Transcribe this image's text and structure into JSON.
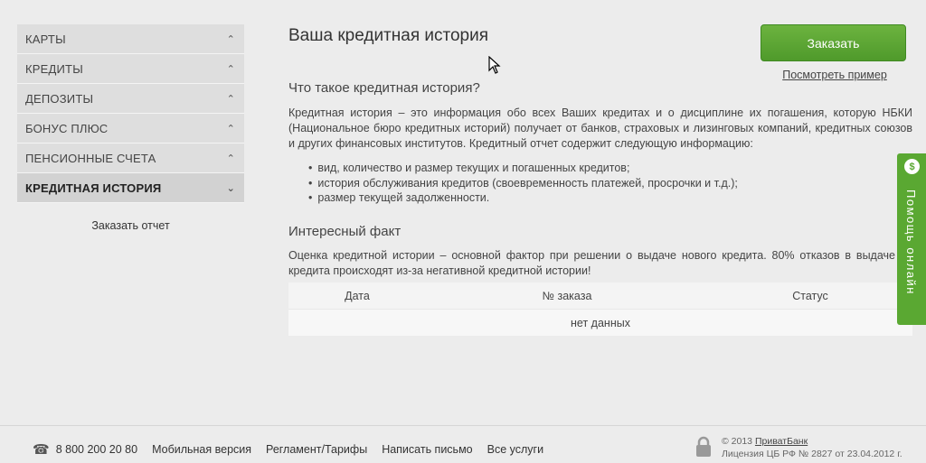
{
  "sidebar": {
    "items": [
      {
        "label": "КАРТЫ"
      },
      {
        "label": "КРЕДИТЫ"
      },
      {
        "label": "ДЕПОЗИТЫ"
      },
      {
        "label": "БОНУС ПЛЮС"
      },
      {
        "label": "ПЕНСИОННЫЕ СЧЕТА"
      },
      {
        "label": "КРЕДИТНАЯ ИСТОРИЯ"
      }
    ],
    "order_report": "Заказать отчет"
  },
  "main": {
    "title": "Ваша кредитная история",
    "what_heading": "Что такое кредитная история?",
    "what_text": "Кредитная история – это информация обо всех Ваших кредитах и о дисциплине их погашения, которую НБКИ (Национальное бюро кредитных историй) получает от банков, страховых и лизинговых компаний, кредитных союзов и других финансовых институтов. Кредитный отчет содержит следующую информацию:",
    "bullets": [
      "вид, количество и размер текущих и погашенных кредитов;",
      "история обслуживания кредитов (своевременность платежей, просрочки и т.д.);",
      "размер текущей задолженности."
    ],
    "fact_heading": "Интересный факт",
    "fact_text": "Оценка кредитной истории – основной фактор при решении о выдаче нового кредита. 80% отказов в выдаче кредита происходят из-за негативной кредитной истории!"
  },
  "order": {
    "button": "Заказать",
    "example_link": "Посмотреть пример"
  },
  "table": {
    "col_date": "Дата",
    "col_number": "№ заказа",
    "col_status": "Статус",
    "empty": "нет данных"
  },
  "help": {
    "icon": "$",
    "label": "Помощь онлайн"
  },
  "footer": {
    "phone": "8 800 200 20 80",
    "mobile": "Мобильная версия",
    "rules": "Регламент/Тарифы",
    "write": "Написать письмо",
    "services": "Все услуги",
    "copyright_prefix": "© 2013 ",
    "bank": "ПриватБанк",
    "license": "Лицензия ЦБ РФ № 2827 от 23.04.2012 г."
  },
  "icons": {
    "chevron_up": "chevron-up-icon",
    "chevron_down": "chevron-down-icon",
    "phone": "phone-icon",
    "lock": "lock-icon",
    "cursor": "mouse-cursor-icon"
  },
  "colors": {
    "accent_green": "#5aa832",
    "background": "#ececec"
  }
}
